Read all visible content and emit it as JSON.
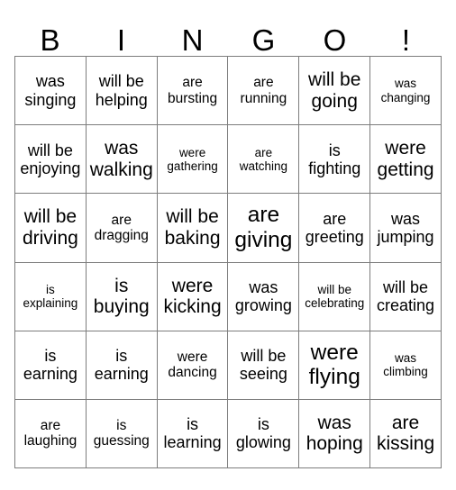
{
  "title": "Bingo Card",
  "header": {
    "letters": [
      "B",
      "I",
      "N",
      "G",
      "O",
      "!"
    ]
  },
  "grid": {
    "columns": 6,
    "rows": 6,
    "cells": [
      [
        {
          "text": "was singing",
          "size": "m"
        },
        {
          "text": "will be helping",
          "size": "m"
        },
        {
          "text": "are bursting",
          "size": "s"
        },
        {
          "text": "are running",
          "size": "s"
        },
        {
          "text": "will be going",
          "size": "l"
        },
        {
          "text": "was changing",
          "size": "xs"
        }
      ],
      [
        {
          "text": "will be enjoying",
          "size": "m"
        },
        {
          "text": "was walking",
          "size": "l"
        },
        {
          "text": "were gathering",
          "size": "xs"
        },
        {
          "text": "are watching",
          "size": "xs"
        },
        {
          "text": "is fighting",
          "size": "m"
        },
        {
          "text": "were getting",
          "size": "l"
        }
      ],
      [
        {
          "text": "will be driving",
          "size": "l"
        },
        {
          "text": "are dragging",
          "size": "s"
        },
        {
          "text": "will be baking",
          "size": "l"
        },
        {
          "text": "are giving",
          "size": "xl"
        },
        {
          "text": "are greeting",
          "size": "m"
        },
        {
          "text": "was jumping",
          "size": "m"
        }
      ],
      [
        {
          "text": "is explaining",
          "size": "xs"
        },
        {
          "text": "is buying",
          "size": "l"
        },
        {
          "text": "were kicking",
          "size": "l"
        },
        {
          "text": "was growing",
          "size": "m"
        },
        {
          "text": "will be celebrating",
          "size": "xs"
        },
        {
          "text": "will be creating",
          "size": "m"
        }
      ],
      [
        {
          "text": "is earning",
          "size": "m"
        },
        {
          "text": "is earning",
          "size": "m"
        },
        {
          "text": "were dancing",
          "size": "s"
        },
        {
          "text": "will be seeing",
          "size": "m"
        },
        {
          "text": "were flying",
          "size": "xl"
        },
        {
          "text": "was climbing",
          "size": "xs"
        }
      ],
      [
        {
          "text": "are laughing",
          "size": "s"
        },
        {
          "text": "is guessing",
          "size": "s"
        },
        {
          "text": "is learning",
          "size": "m"
        },
        {
          "text": "is glowing",
          "size": "m"
        },
        {
          "text": "was hoping",
          "size": "l"
        },
        {
          "text": "are kissing",
          "size": "l"
        }
      ]
    ]
  },
  "colors": {
    "background": "#ffffff",
    "text": "#000000",
    "border": "#7d7d7d"
  }
}
